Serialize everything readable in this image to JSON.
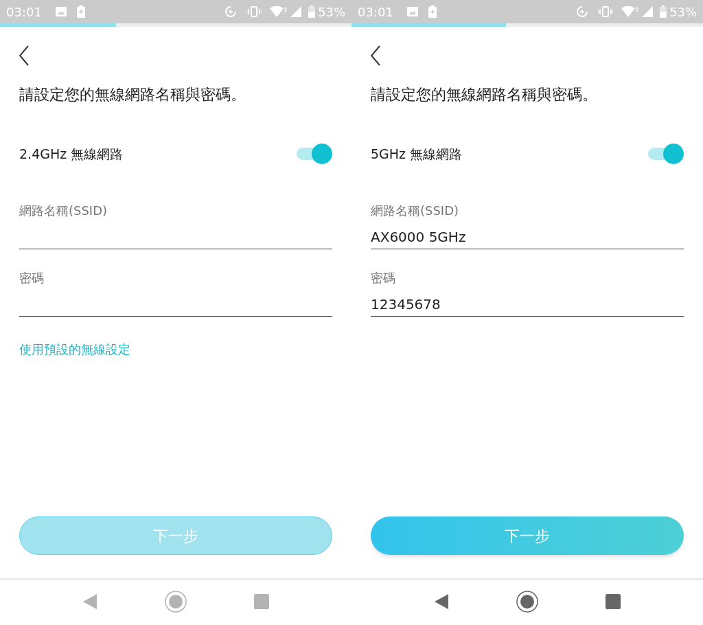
{
  "screens": [
    {
      "status_bar": {
        "time": "03:01",
        "battery": "53%"
      },
      "progress": {
        "level": 0.33
      },
      "title": "請設定您的無線網路名稱與密碼。",
      "band": {
        "label": "2.4GHz 無線網路",
        "on": true
      },
      "fields": [
        {
          "label": "網路名稱(SSID)"
        },
        {
          "label": "密碼"
        }
      ],
      "link": "使用預設的無線設定",
      "next_button": {
        "label": "下一步",
        "disabled": true
      },
      "nav_bar": {
        "dimmed": true
      }
    },
    {
      "status_bar": {
        "time": "03:01",
        "battery": "53%"
      },
      "progress": {
        "level": 0.44
      },
      "title": "請設定您的無線網路名稱與密碼。",
      "band": {
        "label": "5GHz 無線網路",
        "on": true
      },
      "fields": [
        {
          "label": "網路名稱(SSID)",
          "value": "AX6000 5GHz"
        },
        {
          "label": "密碼",
          "value": "12345678"
        }
      ],
      "next_button": {
        "label": "下一步",
        "disabled": false
      },
      "nav_bar": {
        "dimmed": false
      }
    }
  ]
}
